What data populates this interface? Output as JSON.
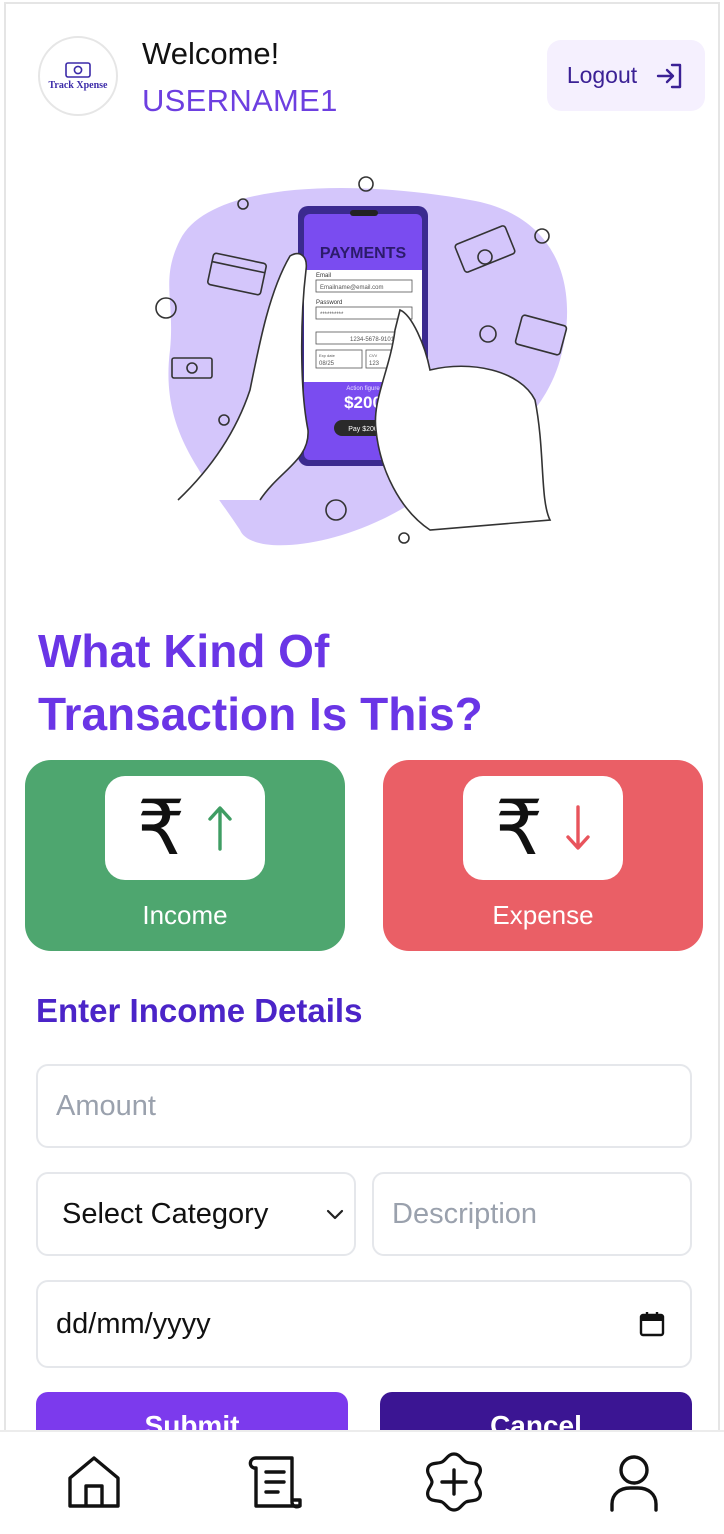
{
  "header": {
    "logo_text": "Track Xpense",
    "welcome": "Welcome!",
    "username": "USERNAME1",
    "logout_label": "Logout"
  },
  "hero": {
    "screen_title": "PAYMENTS",
    "email_label": "Email",
    "email_value": "Emailname@email.com",
    "password_label": "Password",
    "password_value": "**********",
    "card_number": "1234-5678-9101",
    "expiry_label": "Exp date",
    "expiry_value": "08/25",
    "cvv_label": "CVV",
    "cvv_value": "123",
    "amount_label": "Action figure",
    "amount_value": "$200",
    "pay_button": "Pay $200"
  },
  "question": {
    "line1": "What Kind Of",
    "line2": "Transaction Is This?"
  },
  "types": {
    "income_label": "Income",
    "expense_label": "Expense",
    "rupee_symbol": "₹",
    "income_arrow": "↑",
    "expense_arrow": "↓",
    "income_color": "#4ea66f",
    "expense_color": "#ea5f66"
  },
  "form": {
    "title": "Enter Income Details",
    "amount_placeholder": "Amount",
    "category_value": "Select Category",
    "description_placeholder": "Description",
    "date_value": "dd/mm/yyyy",
    "submit_label": "Submit",
    "cancel_label": "Cancel"
  },
  "nav": {
    "icons": [
      "home-icon",
      "receipt-icon",
      "add-icon",
      "user-icon"
    ]
  },
  "colors": {
    "primary": "#6a35e6",
    "dark_primary": "#3b1593"
  }
}
